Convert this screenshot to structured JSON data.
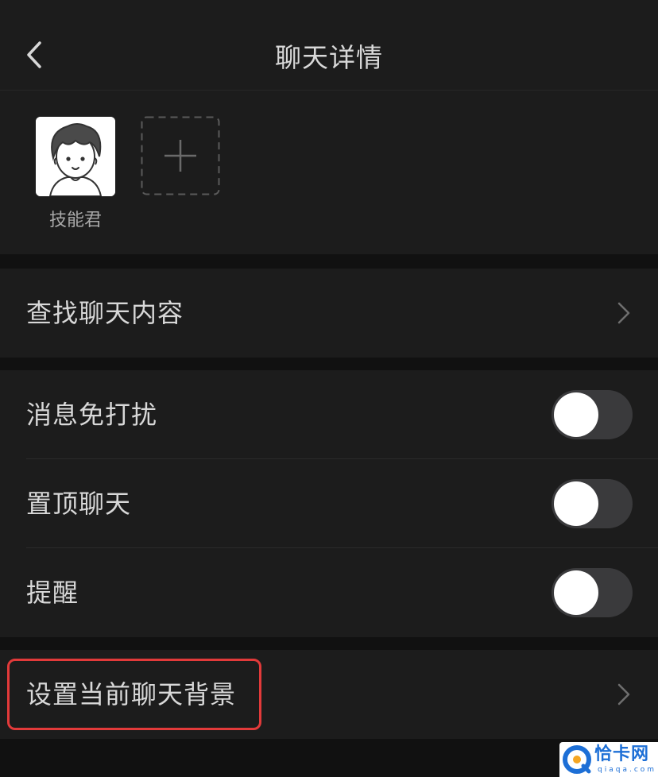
{
  "header": {
    "title": "聊天详情"
  },
  "members": [
    {
      "name": "技能君"
    }
  ],
  "rows": {
    "search_history": {
      "label": "查找聊天内容"
    },
    "mute": {
      "label": "消息免打扰",
      "enabled": false
    },
    "pin_top": {
      "label": "置顶聊天",
      "enabled": false
    },
    "remind": {
      "label": "提醒",
      "enabled": false
    },
    "set_background": {
      "label": "设置当前聊天背景"
    }
  },
  "watermark": {
    "text": "恰卡网",
    "subtext": "qiaqa.com"
  },
  "colors": {
    "background": "#111111",
    "panel": "#1c1c1c",
    "text": "#d8d8d8",
    "toggle_off": "#3a3a3c",
    "highlight": "#e23a3a",
    "watermark_blue": "#1d6fd6"
  },
  "icons": {
    "back": "back-icon",
    "add": "plus-icon",
    "chevron": "chevron-right-icon"
  }
}
